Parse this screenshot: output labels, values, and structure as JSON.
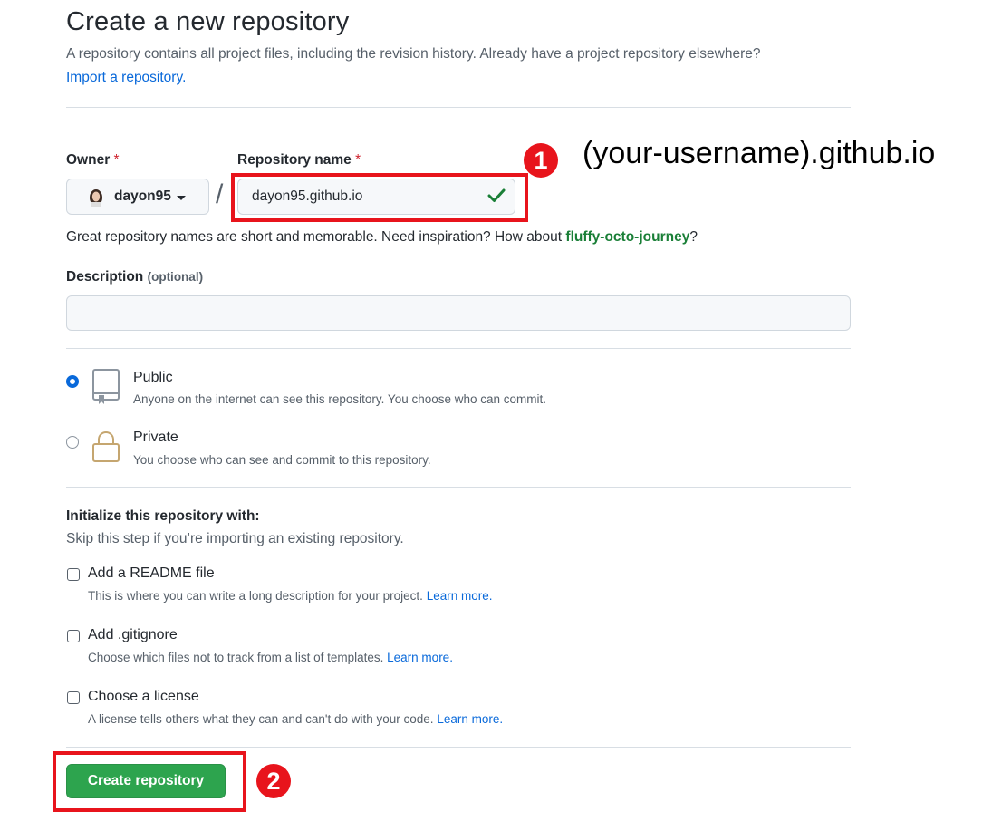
{
  "header": {
    "title": "Create a new repository",
    "subtitle": "A repository contains all project files, including the revision history. Already have a project repository elsewhere?",
    "import_link": "Import a repository."
  },
  "owner": {
    "label": "Owner",
    "required_mark": "*",
    "value": "dayon95"
  },
  "separator": "/",
  "repo_name": {
    "label": "Repository name",
    "required_mark": "*",
    "value": "dayon95.github.io"
  },
  "name_hint": {
    "text": "Great repository names are short and memorable. Need inspiration? How about ",
    "suggestion": "fluffy-octo-journey",
    "suffix": "?"
  },
  "description": {
    "label": "Description",
    "optional": "(optional)",
    "value": ""
  },
  "visibility": {
    "options": [
      {
        "title": "Public",
        "subtitle": "Anyone on the internet can see this repository. You choose who can commit.",
        "selected": true
      },
      {
        "title": "Private",
        "subtitle": "You choose who can see and commit to this repository.",
        "selected": false
      }
    ]
  },
  "init": {
    "heading": "Initialize this repository with:",
    "subheading": "Skip this step if you’re importing an existing repository.",
    "items": [
      {
        "title": "Add a README file",
        "subtitle": "This is where you can write a long description for your project.",
        "link": "Learn more.",
        "checked": false
      },
      {
        "title": "Add .gitignore",
        "subtitle": "Choose which files not to track from a list of templates.",
        "link": "Learn more.",
        "checked": false
      },
      {
        "title": "Choose a license",
        "subtitle": "A license tells others what they can and can't do with your code.",
        "link": "Learn more.",
        "checked": false
      }
    ]
  },
  "create_button": "Create repository",
  "annotations": {
    "step1_number": "1",
    "step1_text": "(your-username).github.io",
    "step2_number": "2"
  },
  "colors": {
    "highlight": "#e8141c",
    "primary_button": "#2da44e",
    "link": "#0969da",
    "suggestion": "#1a7f37"
  }
}
